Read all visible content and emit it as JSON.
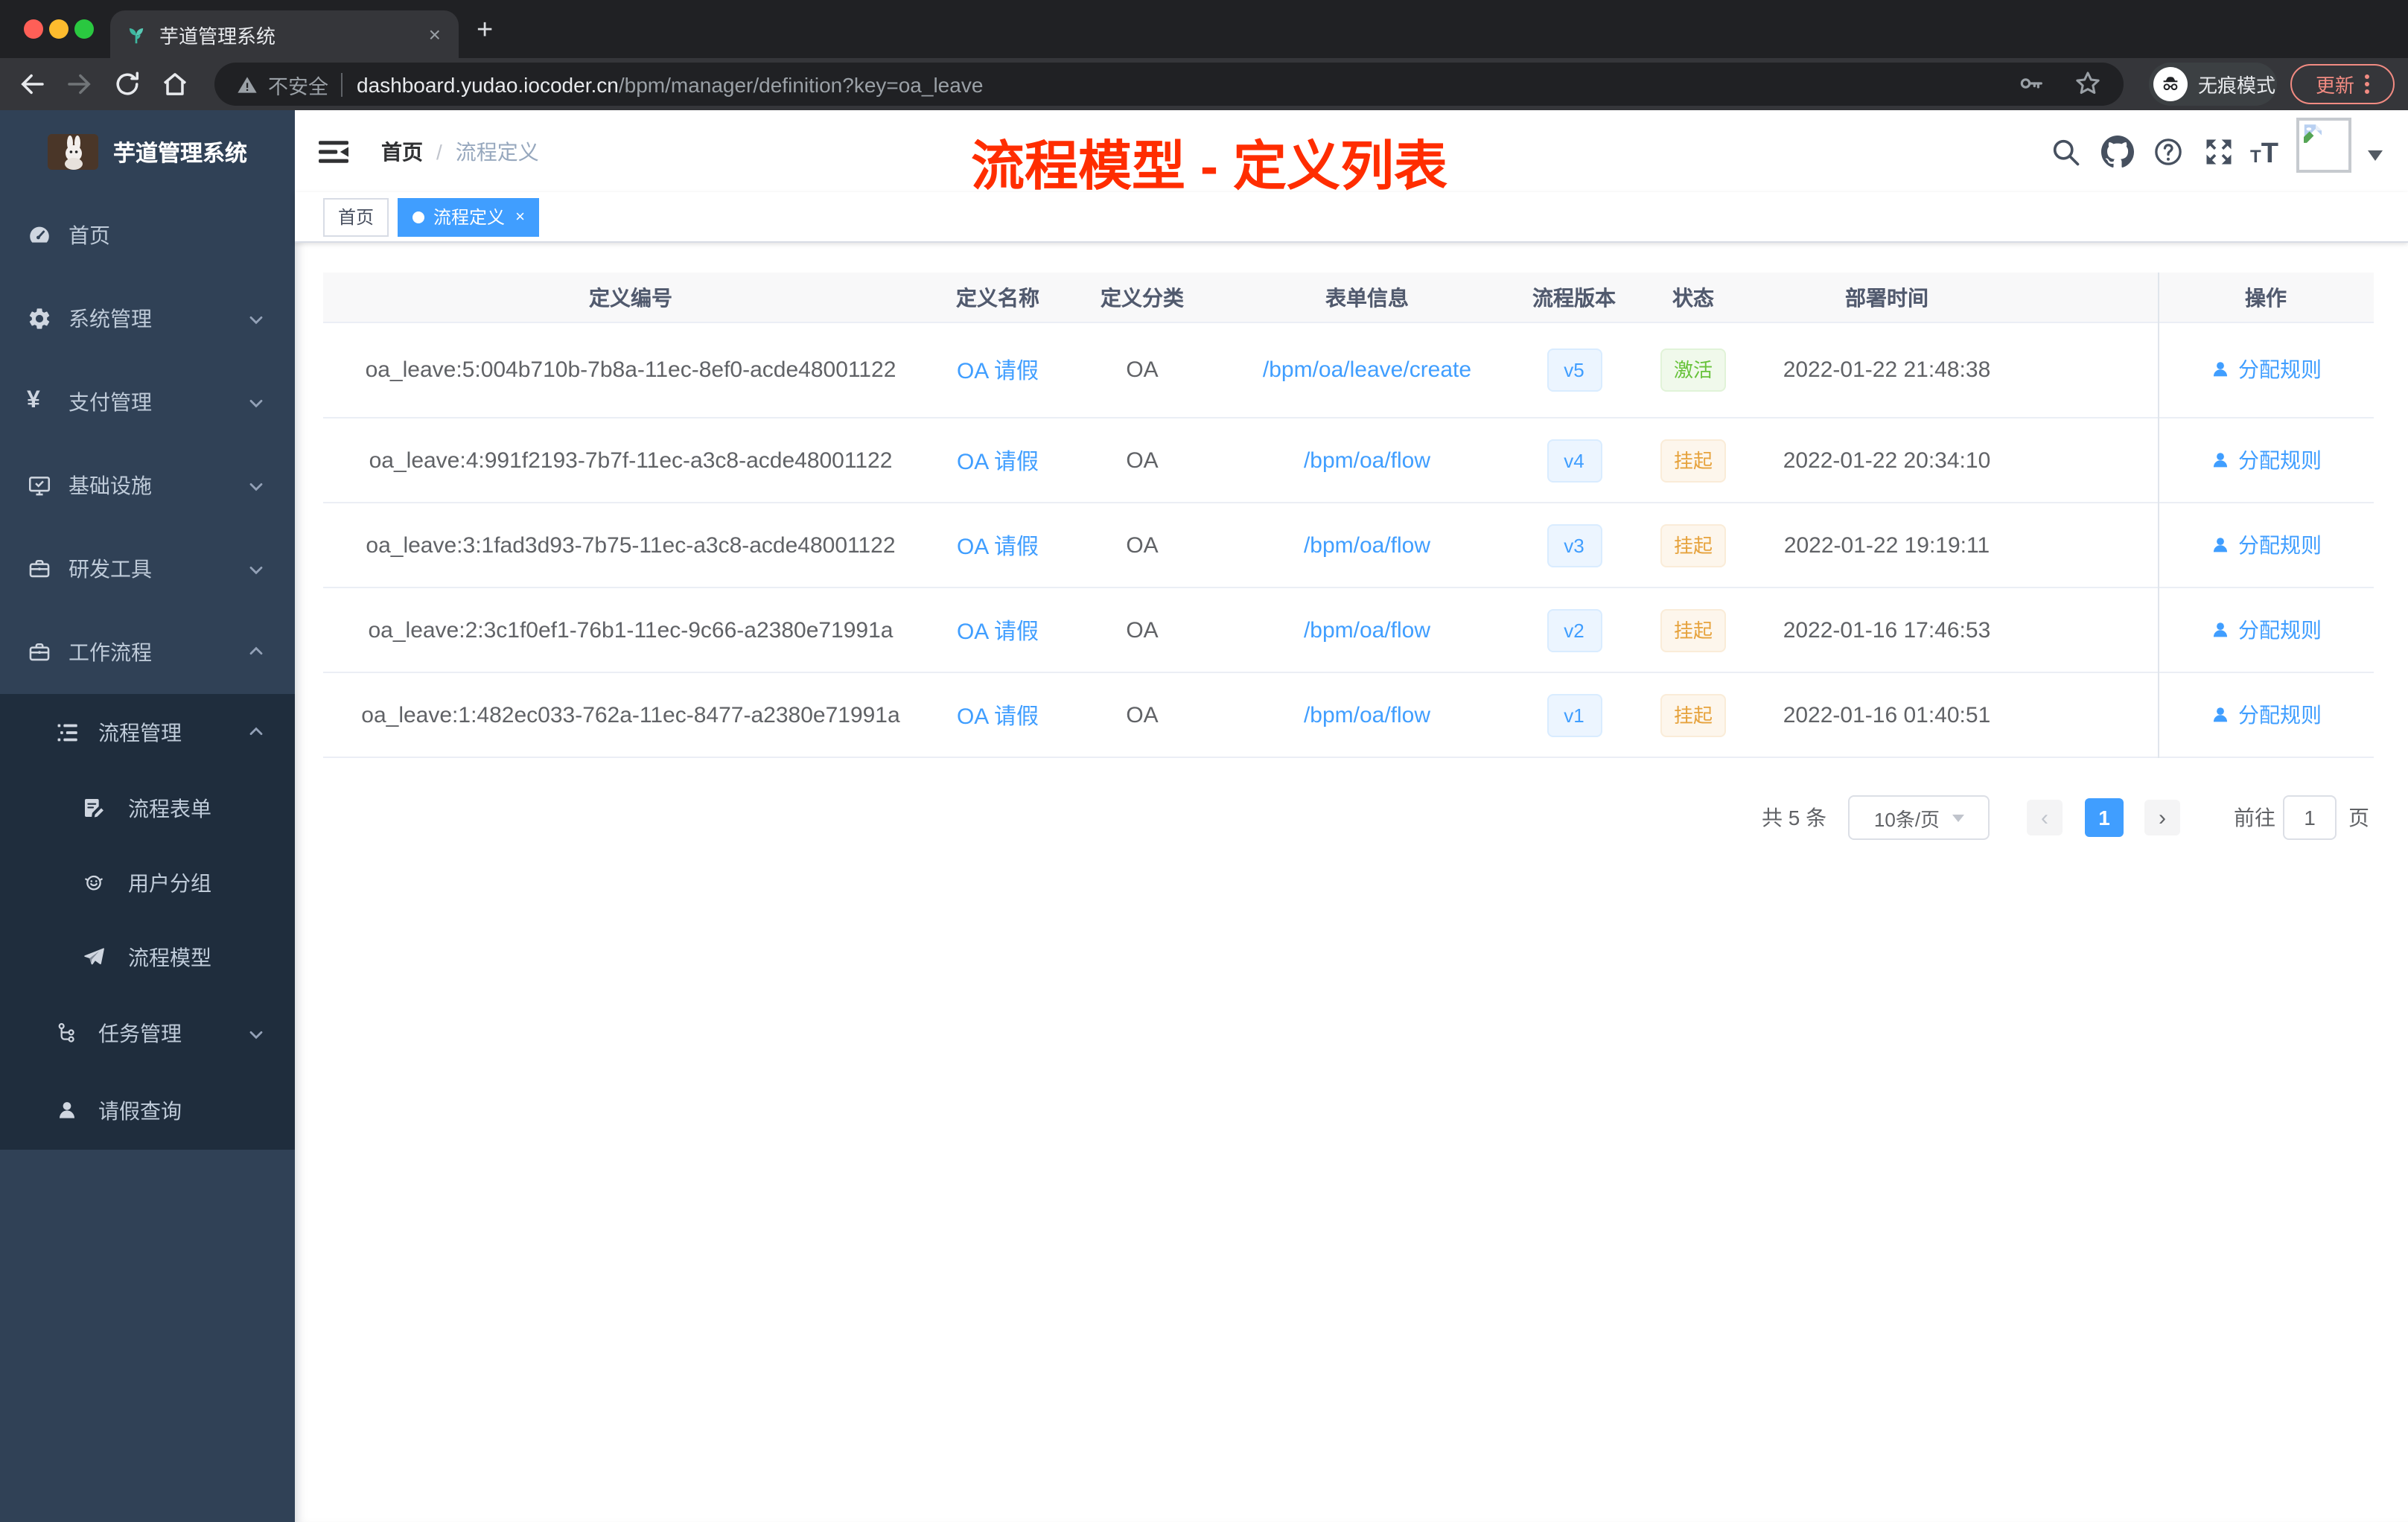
{
  "browser": {
    "tab": {
      "title": "芋道管理系统",
      "close": "×",
      "new_tab": "+"
    },
    "toolbar": {
      "security_label": "不安全",
      "url_domain": "dashboard.yudao.iocoder.cn",
      "url_path": "/bpm/manager/definition?key=oa_leave",
      "incognito_label": "无痕模式",
      "update_label": "更新"
    }
  },
  "sidebar": {
    "logo_title": "芋道管理系统",
    "menu": [
      {
        "label": "首页",
        "icon": "dashboard-icon"
      },
      {
        "label": "系统管理",
        "icon": "gear-icon"
      },
      {
        "label": "支付管理",
        "icon": "yen-icon"
      },
      {
        "label": "基础设施",
        "icon": "monitor-icon"
      },
      {
        "label": "研发工具",
        "icon": "briefcase-icon"
      },
      {
        "label": "工作流程",
        "icon": "briefcase-icon"
      }
    ],
    "workflow_children": [
      {
        "label": "流程管理",
        "icon": "list-tree-icon"
      },
      {
        "label": "流程表单",
        "icon": "form-icon"
      },
      {
        "label": "用户分组",
        "icon": "robot-icon"
      },
      {
        "label": "流程模型",
        "icon": "paper-plane-icon"
      },
      {
        "label": "任务管理",
        "icon": "flow-icon"
      },
      {
        "label": "请假查询",
        "icon": "person-icon"
      }
    ]
  },
  "header": {
    "breadcrumb": {
      "home": "首页",
      "separator": "/",
      "current": "流程定义"
    },
    "annotation": "流程模型 - 定义列表"
  },
  "tags": {
    "home": "首页",
    "active": "流程定义",
    "close": "×"
  },
  "table": {
    "columns": {
      "id": "定义编号",
      "name": "定义名称",
      "category": "定义分类",
      "form": "表单信息",
      "version": "流程版本",
      "status": "状态",
      "deploy_time": "部署时间",
      "action": "操作"
    },
    "rows": [
      {
        "id": "oa_leave:5:004b710b-7b8a-11ec-8ef0-acde48001122",
        "name": "OA 请假",
        "category": "OA",
        "form": "/bpm/oa/leave/create",
        "version": "v5",
        "status": "激活",
        "status_type": "success",
        "deploy_time": "2022-01-22 21:48:38",
        "action": "分配规则"
      },
      {
        "id": "oa_leave:4:991f2193-7b7f-11ec-a3c8-acde48001122",
        "name": "OA 请假",
        "category": "OA",
        "form": "/bpm/oa/flow",
        "version": "v4",
        "status": "挂起",
        "status_type": "warning",
        "deploy_time": "2022-01-22 20:34:10",
        "action": "分配规则"
      },
      {
        "id": "oa_leave:3:1fad3d93-7b75-11ec-a3c8-acde48001122",
        "name": "OA 请假",
        "category": "OA",
        "form": "/bpm/oa/flow",
        "version": "v3",
        "status": "挂起",
        "status_type": "warning",
        "deploy_time": "2022-01-22 19:19:11",
        "action": "分配规则"
      },
      {
        "id": "oa_leave:2:3c1f0ef1-76b1-11ec-9c66-a2380e71991a",
        "name": "OA 请假",
        "category": "OA",
        "form": "/bpm/oa/flow",
        "version": "v2",
        "status": "挂起",
        "status_type": "warning",
        "deploy_time": "2022-01-16 17:46:53",
        "action": "分配规则"
      },
      {
        "id": "oa_leave:1:482ec033-762a-11ec-8477-a2380e71991a",
        "name": "OA 请假",
        "category": "OA",
        "form": "/bpm/oa/flow",
        "version": "v1",
        "status": "挂起",
        "status_type": "warning",
        "deploy_time": "2022-01-16 01:40:51",
        "action": "分配规则"
      }
    ]
  },
  "pagination": {
    "total": "共 5 条",
    "page_size": "10条/页",
    "prev": "‹",
    "current_page": "1",
    "next": "›",
    "goto_label": "前往",
    "goto_value": "1",
    "unit": "页"
  },
  "colors": {
    "accent": "#409EFF",
    "success": "#67C23A",
    "warning": "#E6A23C",
    "sidebar_bg": "#304156",
    "submenu_bg": "#1F2D3D",
    "annotation_red": "#FF2D00",
    "chrome_dark": "#202124",
    "chrome_toolbar": "#35363A"
  }
}
